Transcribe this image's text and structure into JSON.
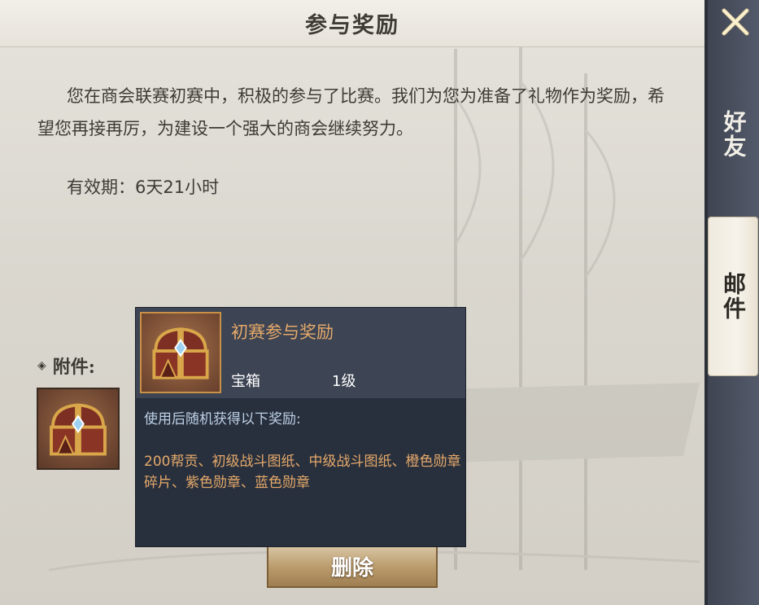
{
  "mail": {
    "title": "参与奖励",
    "body": "您在商会联赛初赛中，积极的参与了比赛。我们为您为准备了礼物作为奖励，希望您再接再厉，为建设一个强大的商会继续努力。",
    "validity": "有效期：6天21小时",
    "attachment_label": "附件:",
    "attachment_icon": "treasure-chest",
    "delete_label": "删除"
  },
  "tooltip": {
    "name": "初赛参与奖励",
    "type": "宝箱",
    "level": "1级",
    "description": "使用后随机获得以下奖励:",
    "rewards": "200帮贡、初级战斗图纸、中级战斗图纸、橙色勋章碎片、紫色勋章、蓝色勋章",
    "icon": "treasure-chest"
  },
  "side": {
    "close_icon": "close-icon",
    "tabs": [
      {
        "label": "好友",
        "active": false
      },
      {
        "label": "邮件",
        "active": true
      }
    ]
  },
  "colors": {
    "item_name": "#e5a96a",
    "description": "#bcd0e6",
    "tooltip_bg": "#29303d",
    "side_bg": "#474c5a"
  }
}
